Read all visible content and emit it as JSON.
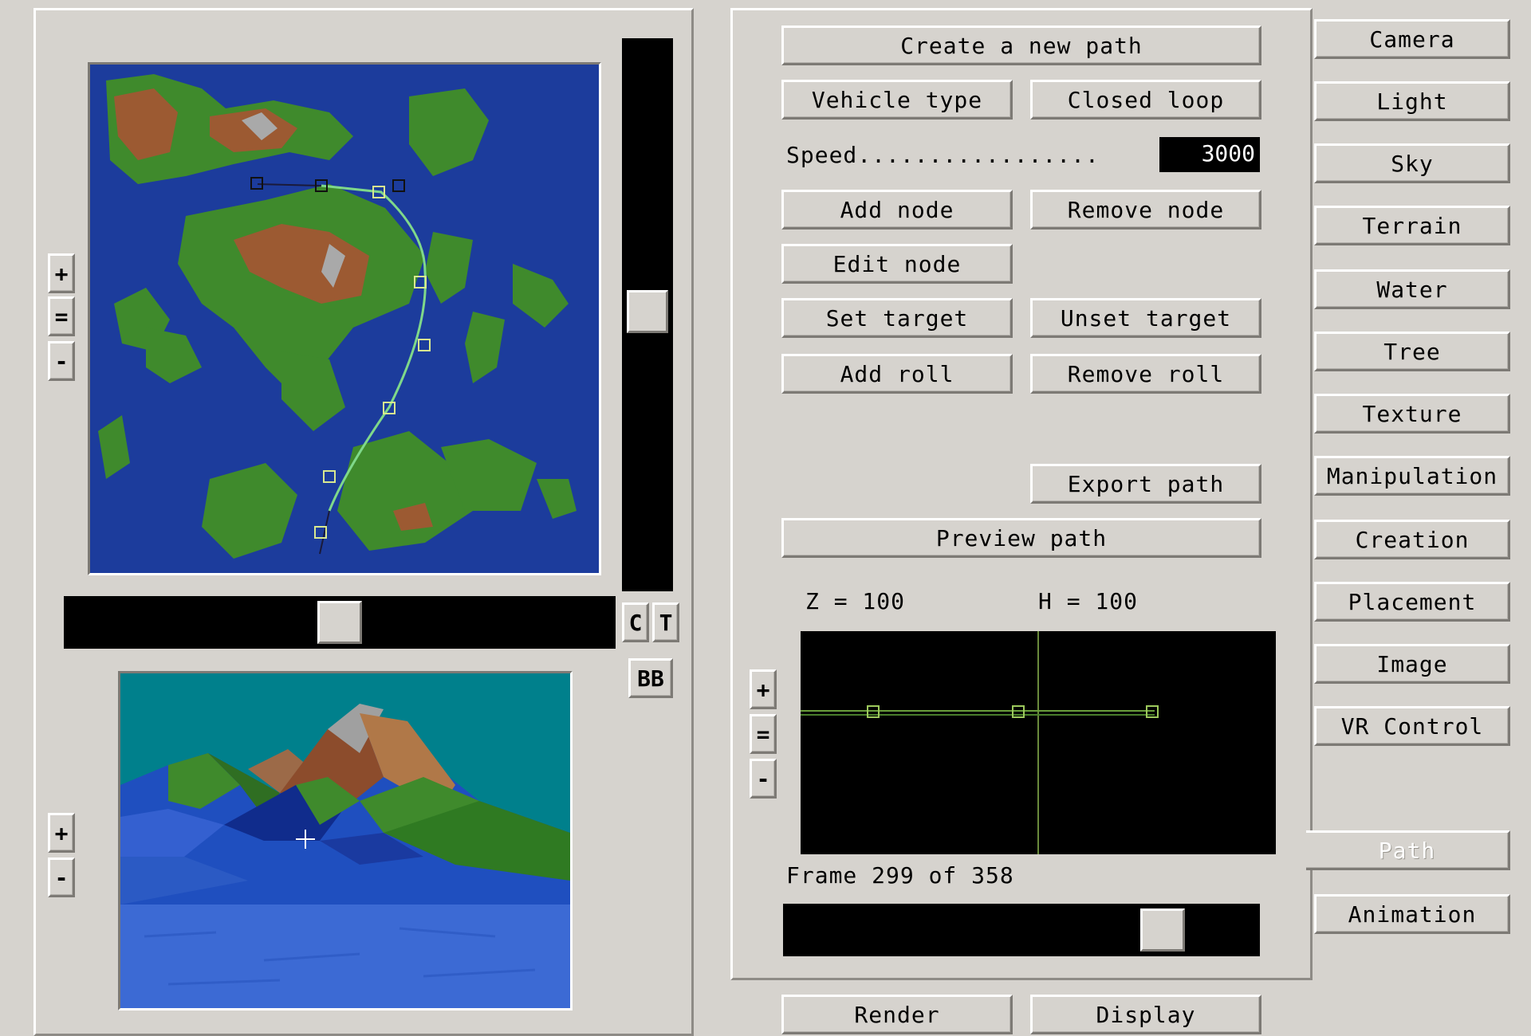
{
  "left_panel": {
    "map_zoom": {
      "plus": "+",
      "equal": "=",
      "minus": "-"
    },
    "view_zoom": {
      "plus": "+",
      "minus": "-"
    },
    "c_button": "C",
    "t_button": "T",
    "bb_button": "BB",
    "horizontal_slider_value": 0.53,
    "vertical_slider_value": 0.49
  },
  "path_panel": {
    "create_path": "Create a new path",
    "vehicle_type": "Vehicle type",
    "closed_loop": "Closed loop",
    "speed_label": "Speed.................",
    "speed_value": "3000",
    "add_node": "Add node",
    "remove_node": "Remove node",
    "edit_node": "Edit node",
    "set_target": "Set target",
    "unset_target": "Unset target",
    "add_roll": "Add roll",
    "remove_roll": "Remove roll",
    "export_path": "Export path",
    "preview_path": "Preview path",
    "z_readout": "Z = 100",
    "h_readout": "H = 100",
    "profile_zoom": {
      "plus": "+",
      "equal": "=",
      "minus": "-"
    },
    "frame_text": "Frame 299 of 358",
    "frame_slider_value": 0.84
  },
  "bottom_buttons": {
    "render": "Render",
    "display": "Display"
  },
  "tabs": [
    {
      "label": "Camera",
      "active": false
    },
    {
      "label": "Light",
      "active": false
    },
    {
      "label": "Sky",
      "active": false
    },
    {
      "label": "Terrain",
      "active": false
    },
    {
      "label": "Water",
      "active": false
    },
    {
      "label": "Tree",
      "active": false
    },
    {
      "label": "Texture",
      "active": false
    },
    {
      "label": "Manipulation",
      "active": false
    },
    {
      "label": "Creation",
      "active": false
    },
    {
      "label": "Placement",
      "active": false
    },
    {
      "label": "Image",
      "active": false
    },
    {
      "label": "VR Control",
      "active": false
    },
    {
      "label": "Path",
      "active": true
    },
    {
      "label": "Animation",
      "active": false
    }
  ],
  "colors": {
    "background": "#d6d3ce",
    "ocean": "#1c3c9c",
    "land": "#3f8a2c",
    "mountain": "#9c5a32",
    "path_line": "#7fd88a",
    "sky": "#00808c"
  },
  "icons": {
    "crosshair": "crosshair-icon",
    "path_node": "square-node-icon"
  }
}
